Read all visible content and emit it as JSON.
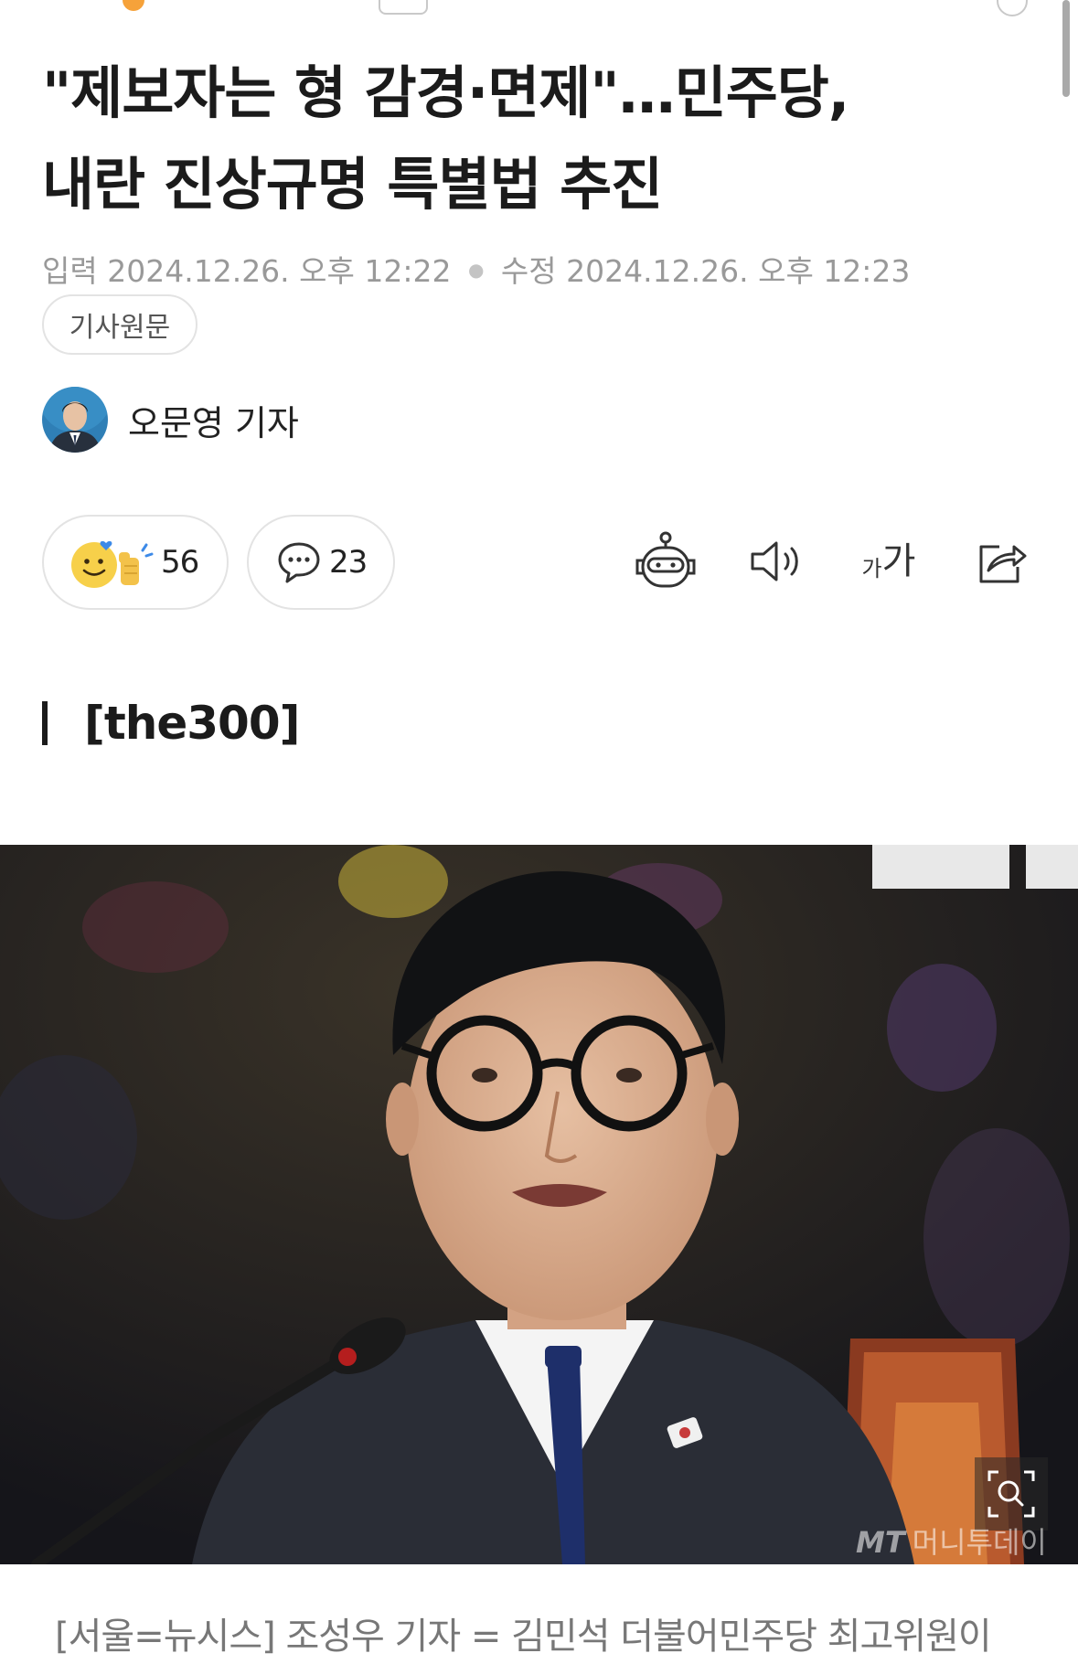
{
  "article": {
    "headline_line1": "\"제보자는 형 감경·면제\"…민주당,",
    "headline_line2": "내란 진상규명 특별법 추진",
    "published_label": "입력",
    "published_at": "2024.12.26. 오후 12:22",
    "modified_label": "수정",
    "modified_at": "2024.12.26. 오후 12:23",
    "original_link_label": "기사원문",
    "author_name": "오문영 기자",
    "section_label": "[the300]",
    "photo_watermark_brand": "MT",
    "photo_watermark_text": "머니투데이",
    "photo_caption": "[서울=뉴시스] 조성우 기자 = 김민석 더불어민주당 최고위원이"
  },
  "engagement": {
    "reactions_count": "56",
    "comments_count": "23"
  },
  "toolbar": {
    "icons": [
      "ai-summary-robot-icon",
      "text-to-speech-icon",
      "font-size-icon",
      "share-icon"
    ],
    "font_size_small": "가",
    "font_size_large": "가"
  },
  "colors": {
    "accent_emoji": "#f7d04a",
    "meta_text": "#999999",
    "pill_border": "#e3e3e3"
  }
}
